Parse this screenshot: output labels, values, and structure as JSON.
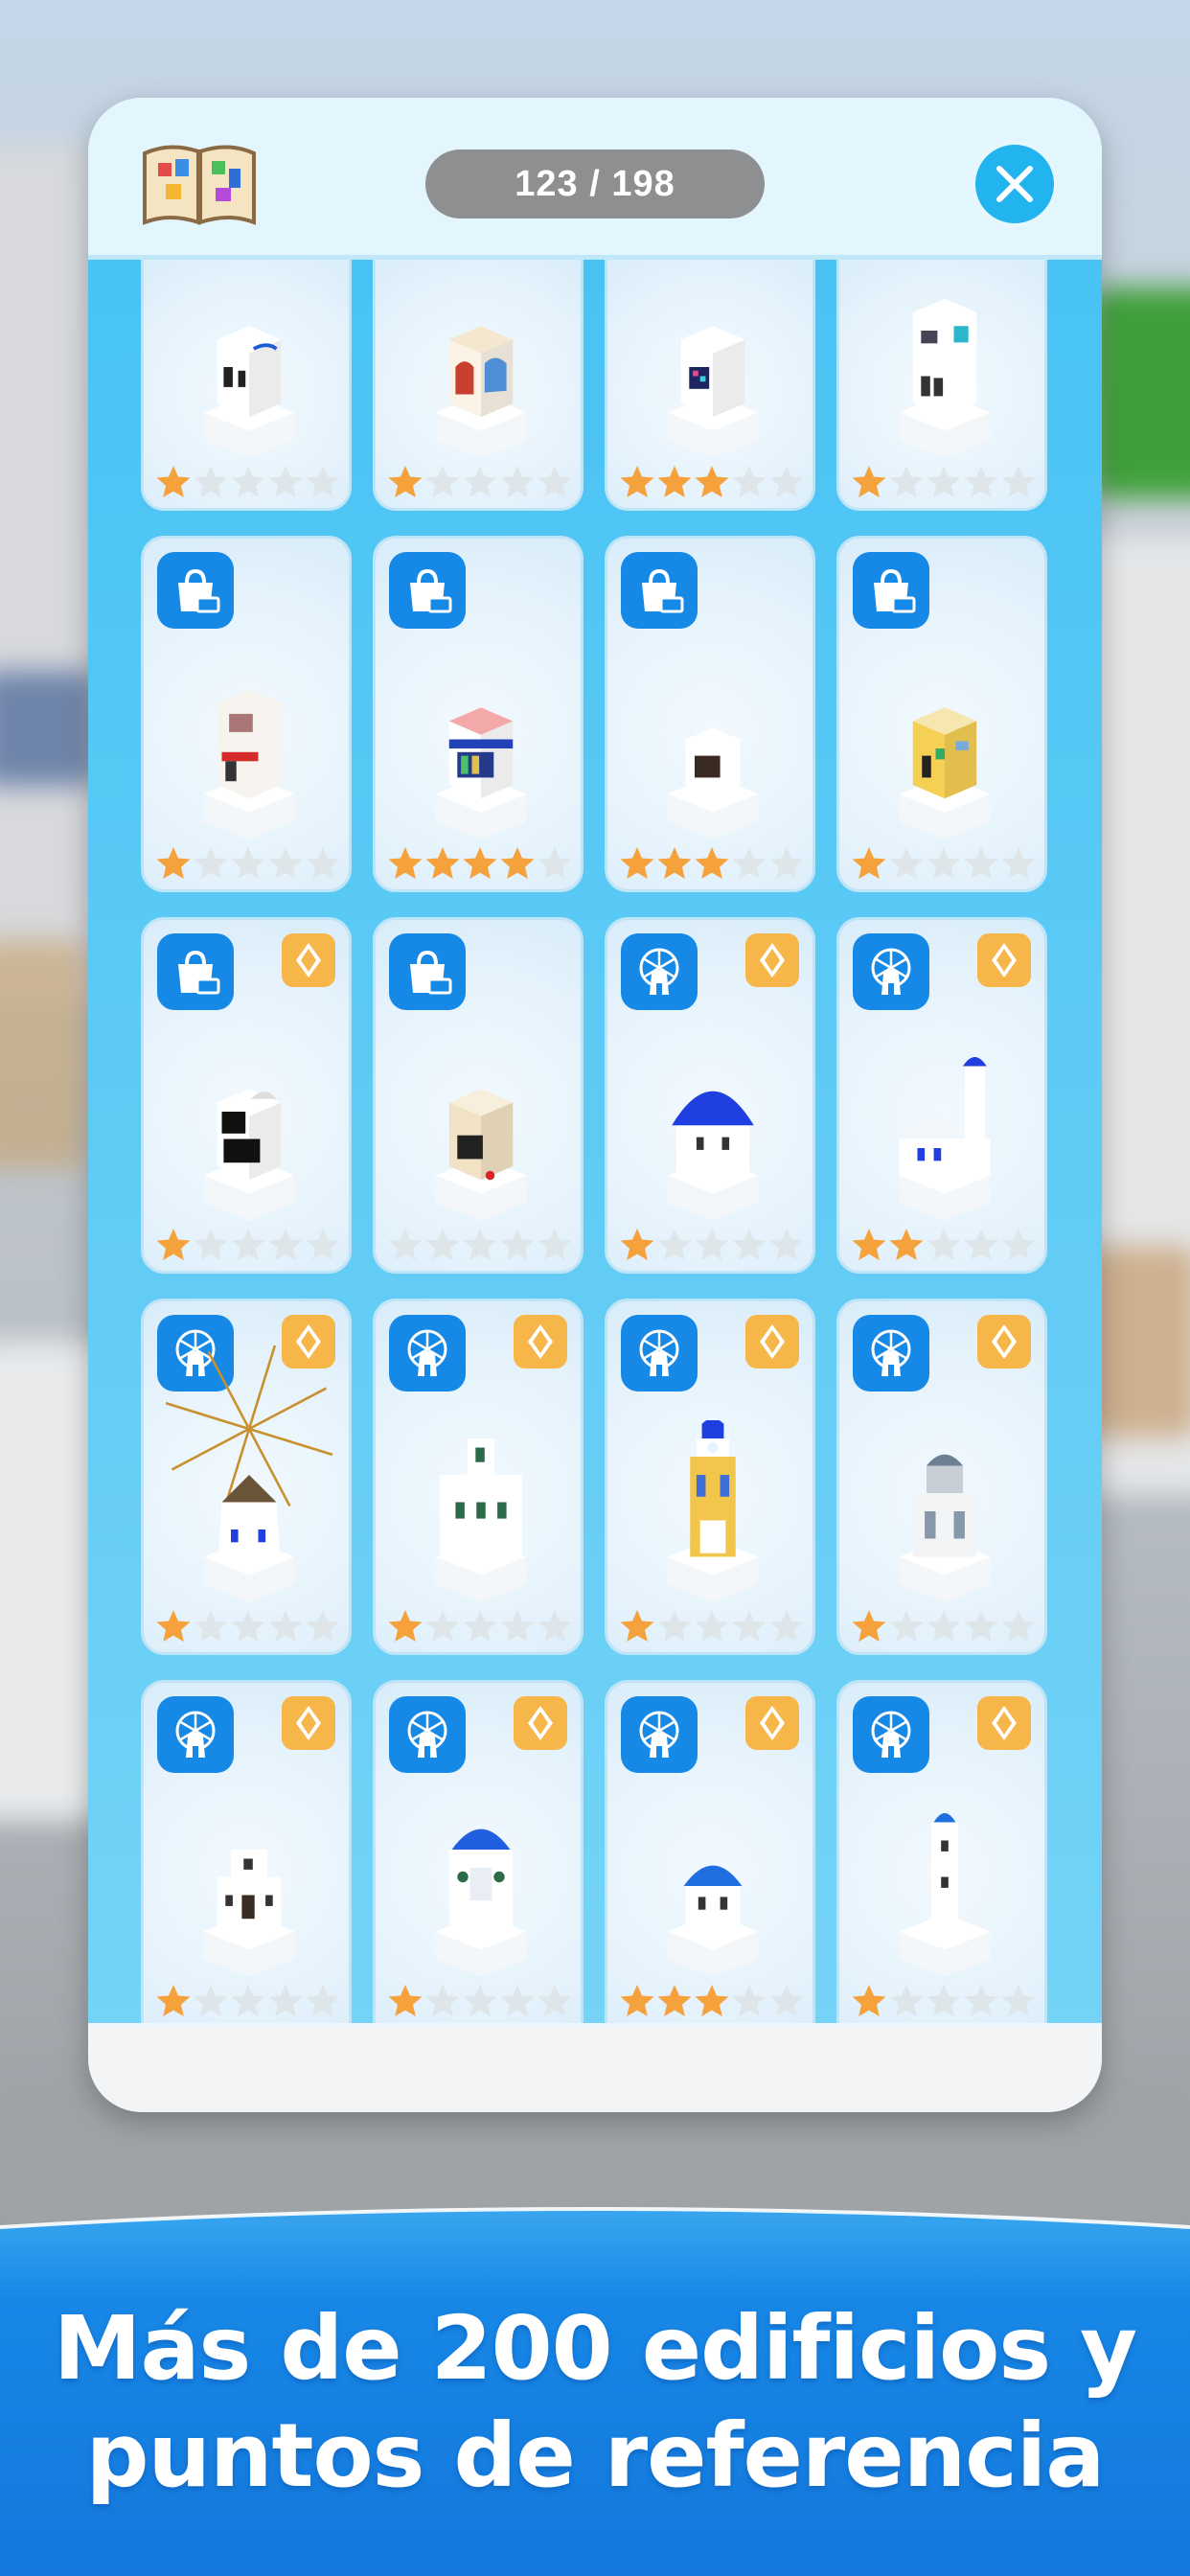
{
  "header": {
    "counter": "123 / 198"
  },
  "colors": {
    "accent": "#22b4ef",
    "badge": "#1689e6",
    "gem": "#f7b64a",
    "star_on": "#f6a23c",
    "star_off": "#dfe6ea",
    "caption_band": "#1580e4"
  },
  "grid": {
    "rows": [
      [
        {
          "badge": "",
          "gem": false,
          "stars": 1,
          "building": "house-small-blue"
        },
        {
          "badge": "",
          "gem": false,
          "stars": 1,
          "building": "shop-arches"
        },
        {
          "badge": "",
          "gem": false,
          "stars": 3,
          "building": "house-blue-window"
        },
        {
          "badge": "",
          "gem": false,
          "stars": 1,
          "building": "house-two-storey"
        }
      ],
      [
        {
          "badge": "shop-icon",
          "gem": false,
          "stars": 1,
          "building": "shop-red-awning"
        },
        {
          "badge": "shop-icon",
          "gem": false,
          "stars": 4,
          "building": "shop-pink-roof"
        },
        {
          "badge": "shop-icon",
          "gem": false,
          "stars": 3,
          "building": "cube-house-open"
        },
        {
          "badge": "shop-icon",
          "gem": false,
          "stars": 1,
          "building": "yellow-house"
        }
      ],
      [
        {
          "badge": "shop-icon",
          "gem": true,
          "stars": 1,
          "building": "dark-window-house"
        },
        {
          "badge": "shop-icon",
          "gem": false,
          "stars": 0,
          "building": "beige-house"
        },
        {
          "badge": "windmill-icon",
          "gem": true,
          "stars": 1,
          "building": "blue-dome-church"
        },
        {
          "badge": "windmill-icon",
          "gem": true,
          "stars": 2,
          "building": "chapel-bell-tower"
        }
      ],
      [
        {
          "badge": "windmill-icon",
          "gem": true,
          "stars": 1,
          "building": "windmill"
        },
        {
          "badge": "windmill-icon",
          "gem": true,
          "stars": 1,
          "building": "bell-wall"
        },
        {
          "badge": "windmill-icon",
          "gem": true,
          "stars": 1,
          "building": "clock-tower"
        },
        {
          "badge": "windmill-icon",
          "gem": true,
          "stars": 1,
          "building": "grey-dome-church"
        }
      ],
      [
        {
          "badge": "windmill-icon",
          "gem": true,
          "stars": 1,
          "building": "small-chapel"
        },
        {
          "badge": "windmill-icon",
          "gem": true,
          "stars": 1,
          "building": "bell-tower-dome"
        },
        {
          "badge": "windmill-icon",
          "gem": true,
          "stars": 3,
          "building": "blue-dome-small"
        },
        {
          "badge": "windmill-icon",
          "gem": true,
          "stars": 1,
          "building": "tall-white-tower"
        }
      ]
    ]
  },
  "caption": {
    "line1": "Más de 200 edificios y",
    "line2": "puntos de referencia"
  }
}
